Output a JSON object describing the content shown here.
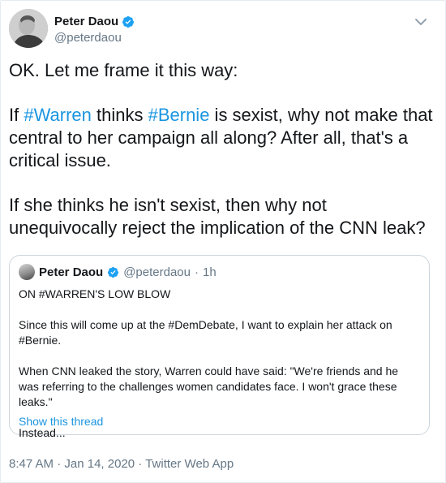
{
  "author": {
    "display_name": "Peter Daou",
    "handle": "@peterdaou",
    "verified": true
  },
  "tweet": {
    "paragraph_1": "OK. Let me frame it this way:",
    "paragraph_2": {
      "pre": "If ",
      "hashtag_1": "#Warren",
      "mid": " thinks ",
      "hashtag_2": "#Bernie",
      "post": " is sexist, why not make that central to her campaign all along? After all, that's a critical issue."
    },
    "paragraph_3": "If she thinks he isn't sexist, then why not unequivocally reject the implication of the CNN leak?"
  },
  "quoted": {
    "display_name": "Peter Daou",
    "handle": "@peterdaou",
    "separator": "·",
    "time": "1h",
    "line_1": "ON #WARREN'S LOW BLOW",
    "line_2": "Since this will come up at the #DemDebate, I want to explain her attack on #Bernie.",
    "line_3": "When CNN leaked the story, Warren could have said: \"We're friends and he was referring to the challenges women candidates face. I won't grace these leaks.\"",
    "line_4": "Instead...",
    "show_thread": "Show this thread"
  },
  "footer": {
    "time": "8:47 AM",
    "separator_1": "·",
    "date": "Jan 14, 2020",
    "separator_2": "·",
    "source": "Twitter Web App"
  },
  "colors": {
    "link": "#1b95e0",
    "verified": "#1da1f2",
    "muted": "#657786",
    "border": "#ccd6dd"
  },
  "icons": {
    "verified": "verified-badge-icon",
    "caret": "chevron-down-icon"
  }
}
